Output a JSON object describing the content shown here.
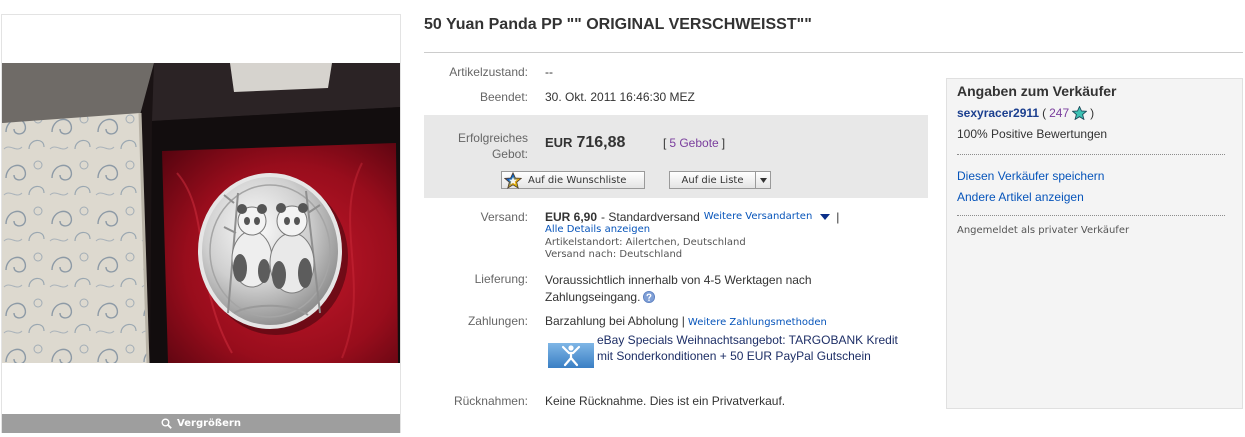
{
  "image": {
    "zoom_label": "Vergrößern"
  },
  "title": "50 Yuan Panda PP \"\" ORIGINAL VERSCHWEISST\"\"",
  "details": {
    "condition": {
      "label": "Artikelzustand:",
      "value": "--"
    },
    "ended": {
      "label": "Beendet:",
      "value": "30. Okt. 2011 16:46:30 MEZ"
    },
    "bid": {
      "label": "Erfolgreiches Gebot:",
      "currency": "EUR",
      "amount": "716,88",
      "bids_open": "[",
      "bids_link": "5 Gebote",
      "bids_close": "]",
      "watchlist_button": "Auf die Wunschliste",
      "list_button": "Auf die Liste"
    },
    "shipping": {
      "label": "Versand:",
      "price": "EUR 6,90",
      "service": "- Standardversand",
      "more_link": "Weitere Versandarten",
      "separator": "|",
      "details_link": "Alle Details anzeigen",
      "location": "Artikelstandort: Ailertchen, Deutschland",
      "ships_to": "Versand nach: Deutschland"
    },
    "delivery": {
      "label": "Lieferung:",
      "text": "Voraussichtlich innerhalb von 4-5 Werktagen nach Zahlungseingang."
    },
    "payments": {
      "label": "Zahlungen:",
      "text": "Barzahlung bei Abholung |",
      "more_link": "Weitere Zahlungsmethoden",
      "promo": "eBay Specials Weihnachtsangebot: TARGOBANK Kredit mit Sonderkonditionen + 50 EUR PayPal Gutschein"
    },
    "returns": {
      "label": "Rücknahmen:",
      "value": "Keine Rücknahme. Dies ist ein Privatverkauf."
    }
  },
  "seller": {
    "heading": "Angaben zum Verkäufer",
    "name": "sexyracer2911",
    "open": "(",
    "score": "247",
    "close": ")",
    "positive": "100% Positive Bewertungen",
    "save_link": "Diesen Verkäufer speichern",
    "other_link": "Andere Artikel anzeigen",
    "note": "Angemeldet als privater Verkäufer"
  },
  "icons": [
    "magnifier-icon",
    "wishlist-star-icon",
    "dropdown-arrow-icon",
    "help-icon",
    "promo-jump-icon",
    "feedback-star-icon"
  ],
  "colors": {
    "link": "#0654ba",
    "bidlink": "#7a3e9d",
    "bidbox": "#e8e8e8",
    "sellerbox": "#f4f4f4"
  }
}
